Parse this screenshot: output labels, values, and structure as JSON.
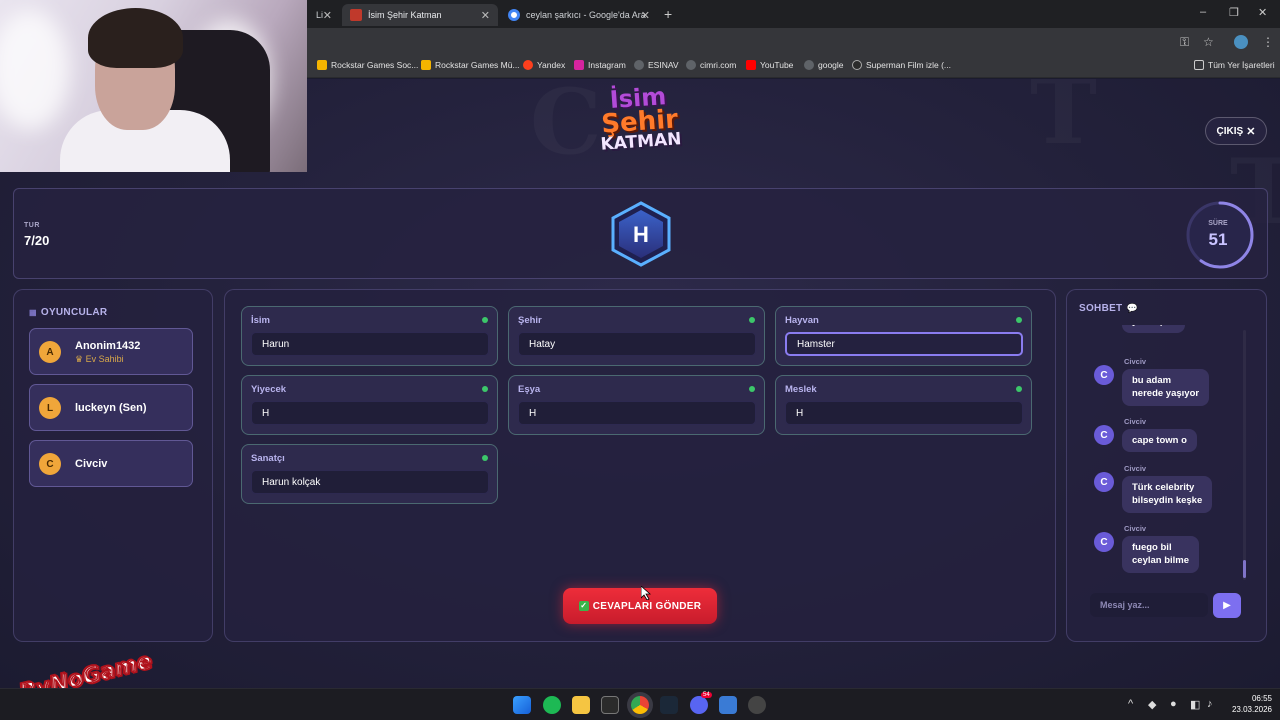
{
  "browser": {
    "tabs": [
      {
        "title": "İsim Şehir Katman",
        "color": "#c0392b",
        "active": true
      },
      {
        "title": "ceylan şarkıcı - Google'da Ara",
        "color": "#4285f4",
        "active": false
      }
    ],
    "partial_tab_title": "Li",
    "new_tab": "+",
    "window_controls": [
      "–",
      "❐",
      "✕"
    ],
    "bookmarks": [
      {
        "label": "Rockstar Games Soc...",
        "color": "#f4b400"
      },
      {
        "label": "Rockstar Games Mü...",
        "color": "#f4b400"
      },
      {
        "label": "Yandex",
        "color": "#fc3f1d"
      },
      {
        "label": "Instagram",
        "color": "#d6249f"
      },
      {
        "label": "ESINAV",
        "color": "#5f6368"
      },
      {
        "label": "cimri.com",
        "color": "#5f6368"
      },
      {
        "label": "YouTube",
        "color": "#ff0000"
      },
      {
        "label": "google",
        "color": "#5f6368"
      },
      {
        "label": "Superman Film izle (...",
        "color": "#2b2b2b"
      }
    ],
    "all_bookmarks": "Tüm Yer İşaretleri"
  },
  "game": {
    "logo": {
      "line1": "İsim",
      "line2": "Şehir",
      "line3": "KATMAN"
    },
    "exit_label": "ÇIKIŞ",
    "round_label": "TUR",
    "round_value": "7/20",
    "letter": "H",
    "timer_label": "SÜRE",
    "timer_value": "51",
    "timer_fraction": 0.6
  },
  "players_panel": {
    "title": "OYUNCULAR",
    "players": [
      {
        "initial": "A",
        "name": "Anonim1432",
        "badge": "Ev Sahibi"
      },
      {
        "initial": "L",
        "name": "luckeyn (Sen)",
        "badge": ""
      },
      {
        "initial": "C",
        "name": "Civciv",
        "badge": ""
      }
    ]
  },
  "fields": [
    {
      "label": "İsim",
      "value": "Harun"
    },
    {
      "label": "Şehir",
      "value": "Hatay"
    },
    {
      "label": "Hayvan",
      "value": "Hamster"
    },
    {
      "label": "Yiyecek",
      "value": "H"
    },
    {
      "label": "Eşya",
      "value": "H"
    },
    {
      "label": "Meslek",
      "value": "H"
    },
    {
      "label": "Sanatçı",
      "value": "Harun kolçak"
    }
  ],
  "submit_label": "CEVAPLARI GÖNDER",
  "chat": {
    "title": "SOHBET",
    "partial_message": "yazmışım",
    "messages": [
      {
        "author": "Civciv",
        "initial": "C",
        "text": "bu adam\nnerede yaşıyor"
      },
      {
        "author": "Civciv",
        "initial": "C",
        "text": "cape town o"
      },
      {
        "author": "Civciv",
        "initial": "C",
        "text": "Türk celebrity\nbilseydin keşke"
      },
      {
        "author": "Civciv",
        "initial": "C",
        "text": "fuego bil\nceylan bilme"
      }
    ],
    "input_placeholder": "Mesaj yaz...",
    "send_icon": "▶"
  },
  "taskbar": {
    "time": "06:55",
    "date": "23.03.2026",
    "discord_badge": "54"
  },
  "watermark": {
    "text": "ByNoGame"
  },
  "colors": {
    "accent": "#7d6ff0",
    "submit": "#e02636",
    "online_dot": "#3cc76a",
    "host_badge": "#d8a84a"
  }
}
